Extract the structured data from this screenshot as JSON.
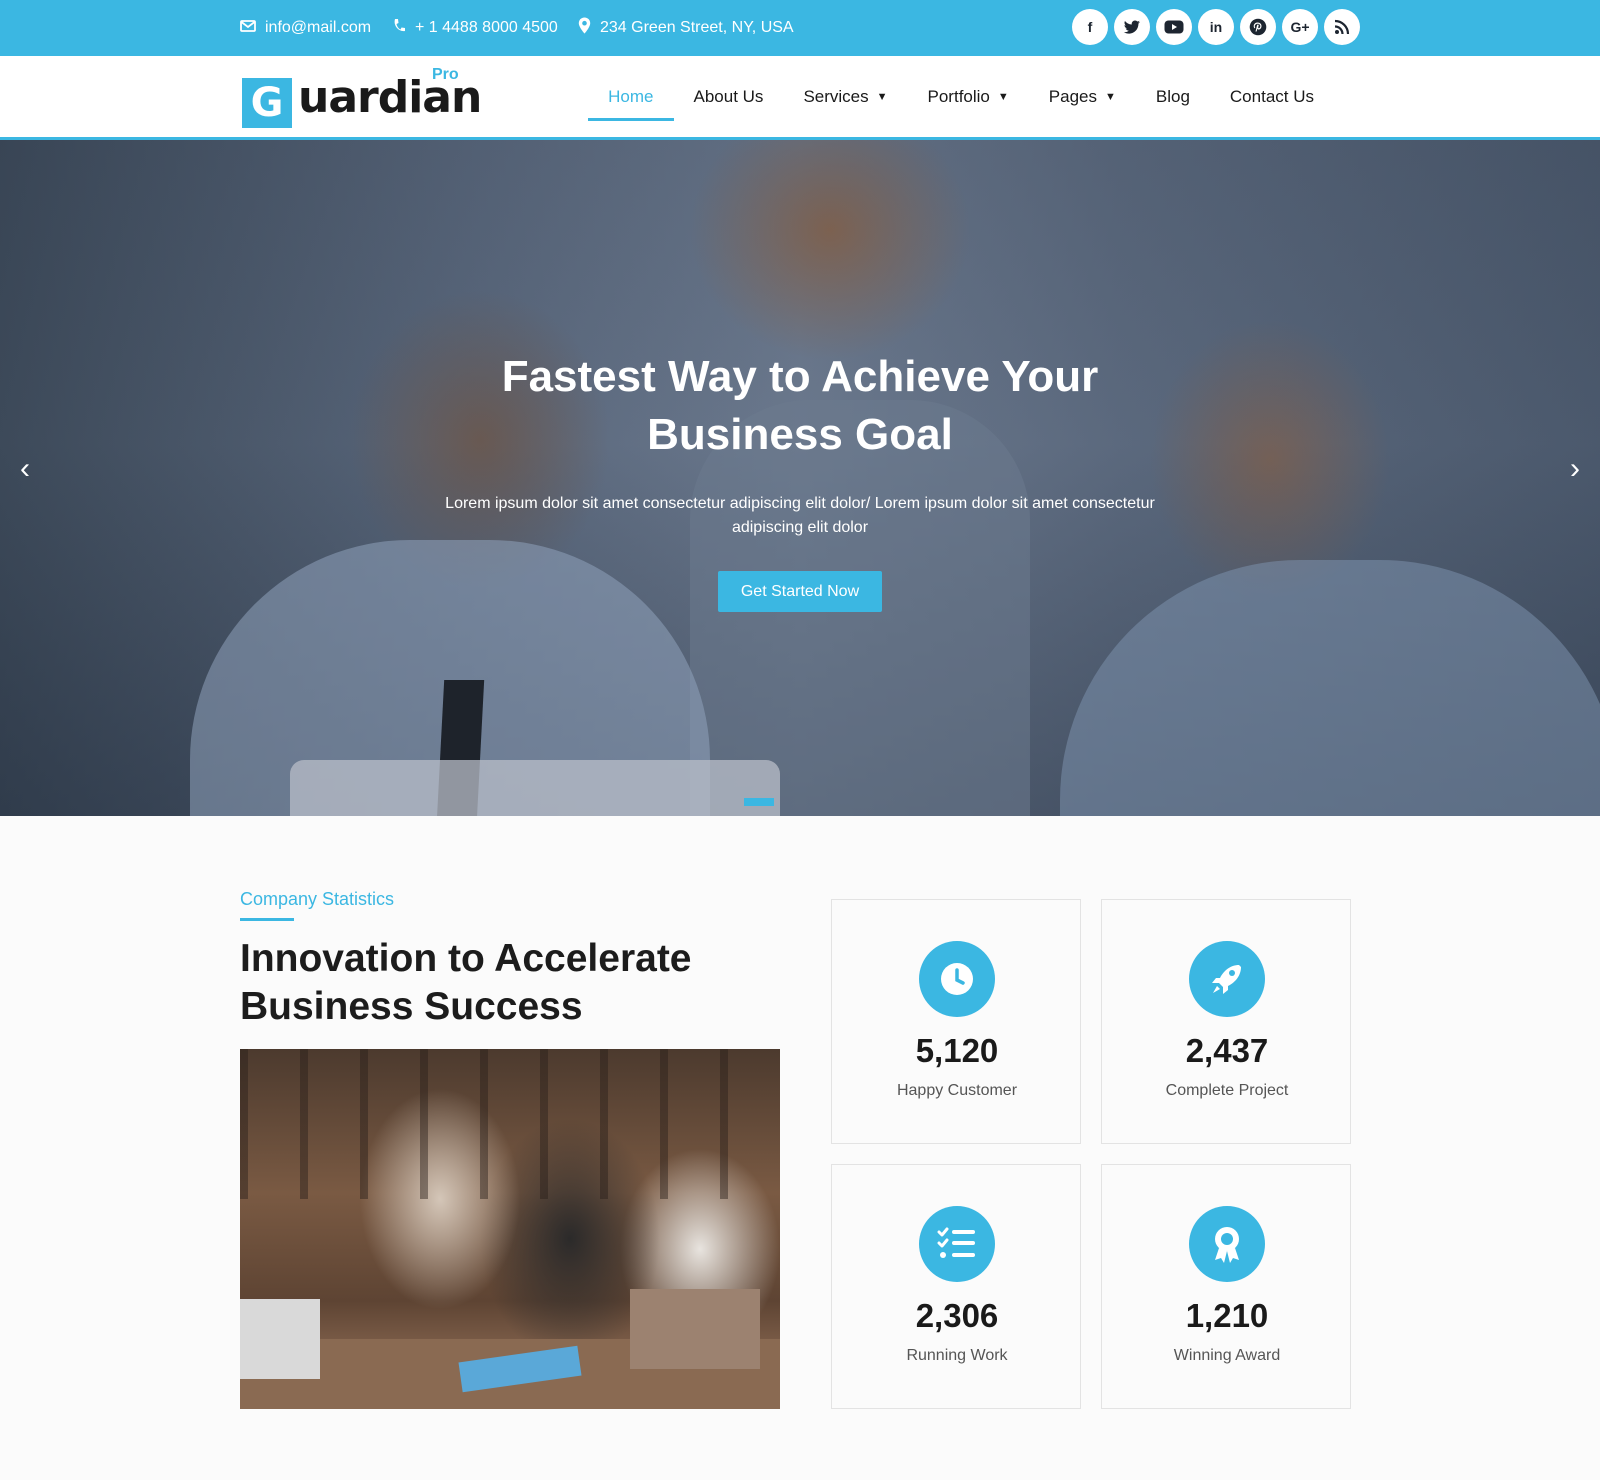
{
  "topbar": {
    "email": "info@mail.com",
    "phone": "+ 1 4488 8000 4500",
    "address": "234 Green Street, NY, USA",
    "socials": [
      {
        "name": "facebook-icon",
        "glyph": "f"
      },
      {
        "name": "twitter-icon",
        "glyph": "t"
      },
      {
        "name": "youtube-icon",
        "glyph": "▶"
      },
      {
        "name": "linkedin-icon",
        "glyph": "in"
      },
      {
        "name": "pinterest-icon",
        "glyph": "P"
      },
      {
        "name": "google-plus-icon",
        "glyph": "G+"
      },
      {
        "name": "rss-icon",
        "glyph": "◉"
      }
    ]
  },
  "logo": {
    "letter": "G",
    "word": "uardian",
    "badge": "Pro"
  },
  "nav": {
    "items": [
      {
        "label": "Home",
        "active": true
      },
      {
        "label": "About Us"
      },
      {
        "label": "Services",
        "dropdown": true
      },
      {
        "label": "Portfolio",
        "dropdown": true
      },
      {
        "label": "Pages",
        "dropdown": true
      },
      {
        "label": "Blog"
      },
      {
        "label": "Contact Us"
      }
    ]
  },
  "hero": {
    "title_line1": "Fastest Way to Achieve Your",
    "title_line2": "Business Goal",
    "text": "Lorem ipsum dolor sit amet consectetur adipiscing elit dolor/ Lorem ipsum dolor sit amet consectetur adipiscing elit dolor",
    "button": "Get Started Now",
    "prev_arrow": "‹",
    "next_arrow": "›"
  },
  "stats": {
    "eyebrow": "Company Statistics",
    "title_line1": "Innovation to Accelerate",
    "title_line2": "Business Success",
    "cards": [
      {
        "value": "5,120",
        "label": "Happy Customer",
        "icon": "clock-icon"
      },
      {
        "value": "2,437",
        "label": "Complete Project",
        "icon": "rocket-icon"
      },
      {
        "value": "2,306",
        "label": "Running Work",
        "icon": "checklist-icon"
      },
      {
        "value": "1,210",
        "label": "Winning Award",
        "icon": "award-icon"
      }
    ]
  },
  "colors": {
    "accent": "#3bb7e2",
    "text_dark": "#1a1a1a",
    "text_muted": "#555555"
  }
}
